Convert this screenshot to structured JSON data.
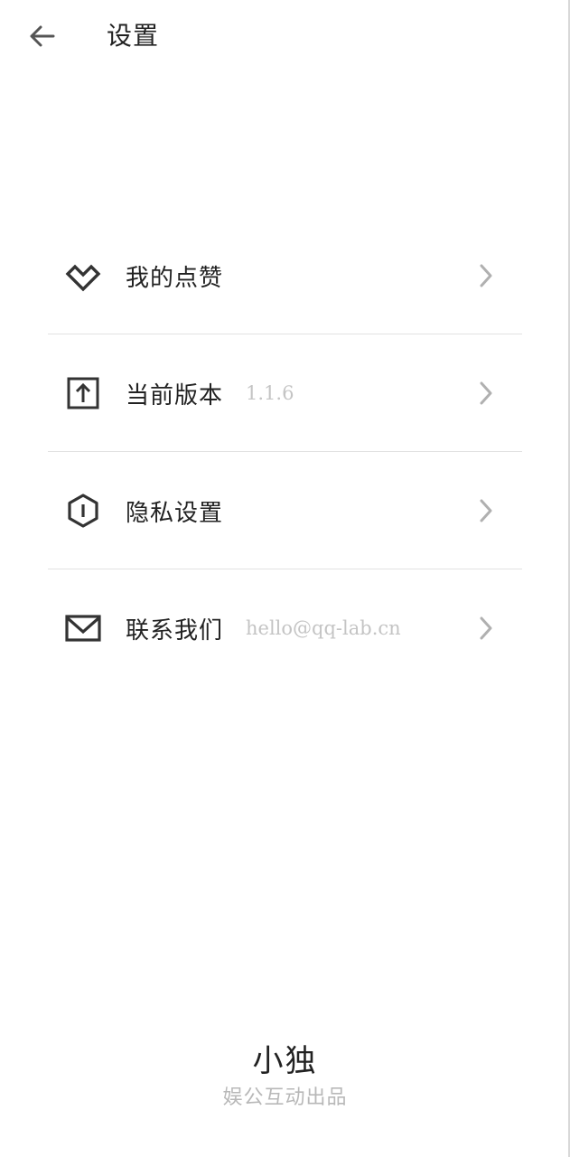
{
  "header": {
    "title": "设置",
    "back_icon": "arrow-left-icon"
  },
  "menu": {
    "items": [
      {
        "label": "我的点赞",
        "value": "",
        "icon": "heart-diamond-icon"
      },
      {
        "label": "当前版本",
        "value": "1.1.6",
        "icon": "upload-box-icon"
      },
      {
        "label": "隐私设置",
        "value": "",
        "icon": "shield-hexagon-icon"
      },
      {
        "label": "联系我们",
        "value": "hello@qq-lab.cn",
        "icon": "mail-icon"
      }
    ],
    "chevron_icon": "chevron-right-icon"
  },
  "footer": {
    "brand": "小独",
    "producer": "娱公互动出品"
  },
  "colors": {
    "text_primary": "#222222",
    "text_muted": "#c4c4c4",
    "icon": "#333333",
    "chevron": "#b0b0b0",
    "divider": "#e2e2e2",
    "background": "#ffffff"
  }
}
